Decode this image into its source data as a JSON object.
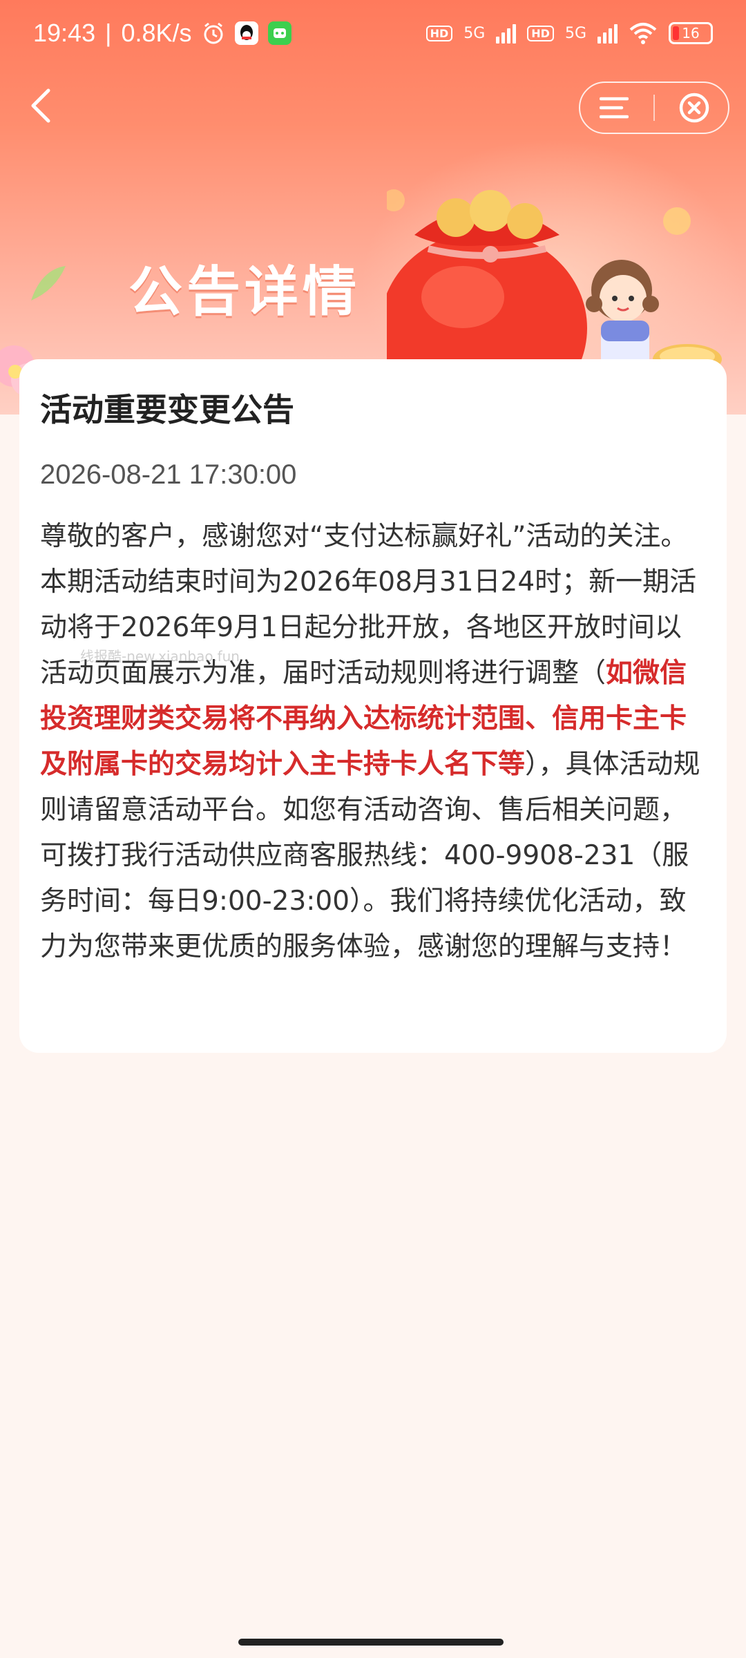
{
  "status_bar": {
    "time": "19:43",
    "net_speed": "0.8K/s",
    "signal1_label": "5G",
    "signal2_label": "5G",
    "hd_label": "HD",
    "battery": "16"
  },
  "nav": {
    "back_icon": "chevron-left-icon",
    "menu_icon": "menu-icon",
    "close_icon": "close-circle-icon"
  },
  "banner": {
    "title": "公告详情"
  },
  "notice": {
    "title": "活动重要变更公告",
    "time": "2026-08-21 17:30:00",
    "body_part1": "尊敬的客户，感谢您对“支付达标赢好礼”活动的关注。本期活动结束时间为2026年08月31日24时；新一期活动将于2026年9月1日起分批开放，各地区开放时间以活动页面展示为准，届时活动规则将进行调整（",
    "body_highlight": "如微信投资理财类交易将不再纳入达标统计范围、信用卡主卡及附属卡的交易均计入主卡持卡人名下等",
    "body_part2": "），具体活动规则请留意活动平台。如您有活动咨询、售后相关问题，可拨打我行活动供应商客服热线：400-9908-231（服务时间：每日9:00-23:00）。我们将持续优化活动，致力为您带来更优质的服务体验，感谢您的理解与支持！"
  },
  "watermark": "线报酷-new.xianbao.fun",
  "colors": {
    "banner_top": "#ff7a5c",
    "highlight": "#d62b2b",
    "page_bg": "#fef5f1"
  }
}
